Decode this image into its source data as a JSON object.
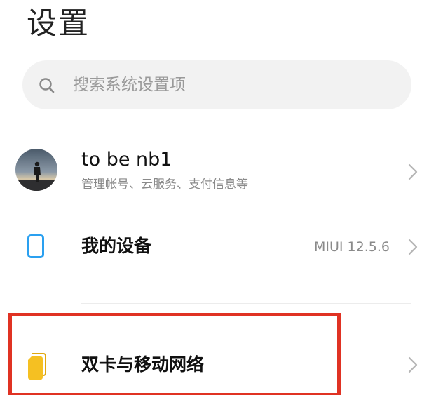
{
  "page_title": "设置",
  "search": {
    "placeholder": "搜索系统设置项",
    "icon": "search-icon"
  },
  "account": {
    "name": "to be nb1",
    "subtitle": "管理帐号、云服务、支付信息等",
    "icon": "avatar"
  },
  "my_device": {
    "label": "我的设备",
    "version": "MIUI 12.5.6",
    "icon": "phone-icon"
  },
  "dual_sim": {
    "label": "双卡与移动网络",
    "icon": "sim-card-icon"
  },
  "colors": {
    "device_icon": "#2aa0f0",
    "sim_icon": "#f5c022",
    "highlight": "#e03223"
  }
}
